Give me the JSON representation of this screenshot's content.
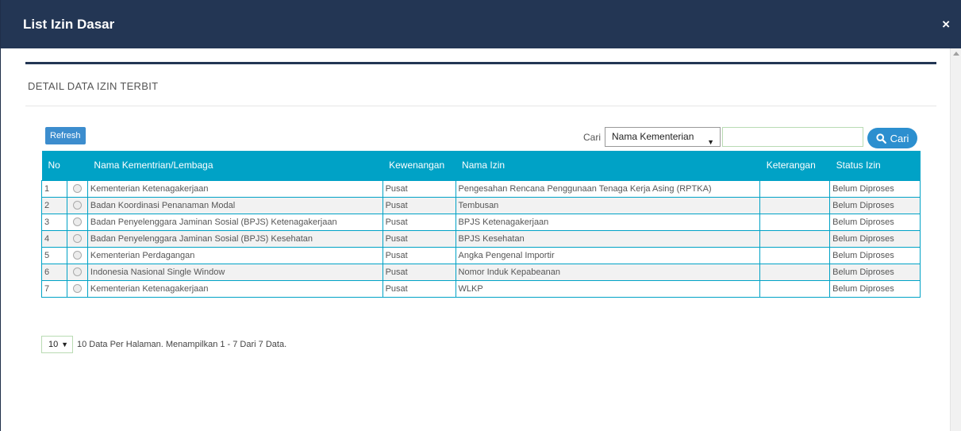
{
  "modal": {
    "title": "List Izin Dasar",
    "close_glyph": "×"
  },
  "section": {
    "title": "DETAIL DATA IZIN TERBIT"
  },
  "toolbar": {
    "refresh_label": "Refresh",
    "search_label": "Cari",
    "search_field_selected": "Nama Kementerian",
    "search_value": "",
    "search_button_label": "Cari",
    "search_button_icon": "search-icon"
  },
  "table": {
    "headers": {
      "no": "No",
      "radio": "",
      "agency": "Nama Kementrian/Lembaga",
      "authority": "Kewenangan",
      "permit": "Nama Izin",
      "note": "Keterangan",
      "status": "Status Izin"
    },
    "rows": [
      {
        "no": "1",
        "agency": "Kementerian Ketenagakerjaan",
        "authority": "Pusat",
        "permit": "Pengesahan Rencana Penggunaan Tenaga Kerja Asing (RPTKA)",
        "note": "",
        "status": "Belum Diproses"
      },
      {
        "no": "2",
        "agency": "Badan Koordinasi Penanaman Modal",
        "authority": "Pusat",
        "permit": "Tembusan",
        "note": "",
        "status": "Belum Diproses"
      },
      {
        "no": "3",
        "agency": "Badan Penyelenggara Jaminan Sosial (BPJS) Ketenagakerjaan",
        "authority": "Pusat",
        "permit": "BPJS Ketenagakerjaan",
        "note": "",
        "status": "Belum Diproses"
      },
      {
        "no": "4",
        "agency": "Badan Penyelenggara Jaminan Sosial (BPJS) Kesehatan",
        "authority": "Pusat",
        "permit": "BPJS Kesehatan",
        "note": "",
        "status": "Belum Diproses"
      },
      {
        "no": "5",
        "agency": "Kementerian Perdagangan",
        "authority": "Pusat",
        "permit": "Angka Pengenal Importir",
        "note": "",
        "status": "Belum Diproses"
      },
      {
        "no": "6",
        "agency": "Indonesia Nasional Single Window",
        "authority": "Pusat",
        "permit": "Nomor Induk Kepabeanan",
        "note": "",
        "status": "Belum Diproses"
      },
      {
        "no": "7",
        "agency": "Kementerian Ketenagakerjaan",
        "authority": "Pusat",
        "permit": "WLKP",
        "note": "",
        "status": "Belum Diproses"
      }
    ]
  },
  "pager": {
    "per_page": "10",
    "summary": "10 Data Per Halaman. Menampilkan 1 - 7 Dari 7 Data."
  },
  "colors": {
    "header_bg": "#233654",
    "table_header": "#00a2c6",
    "button": "#2c8fcf"
  }
}
